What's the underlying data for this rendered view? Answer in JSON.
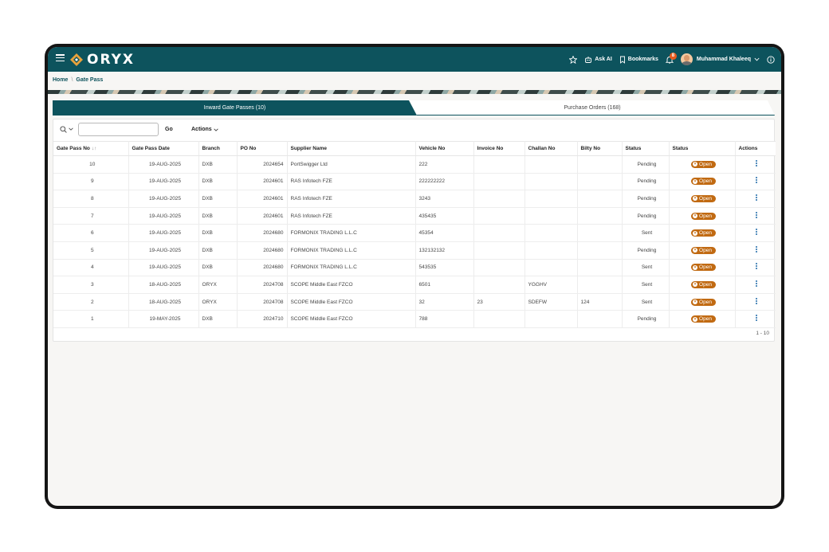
{
  "app": {
    "name": "ORYX"
  },
  "header": {
    "ask_ai": "Ask AI",
    "bookmarks": "Bookmarks",
    "notification_count": "8",
    "user_name": "Muhammad Khaleeq"
  },
  "breadcrumb": {
    "home": "Home",
    "sep": "\\",
    "current": "Gate Pass"
  },
  "tabs": [
    {
      "label": "Inward Gate Passes (10)"
    },
    {
      "label": "Purchase Orders (168)"
    }
  ],
  "toolbar": {
    "search_value": "",
    "go_label": "Go",
    "actions_label": "Actions"
  },
  "table": {
    "columns": [
      "Gate Pass No",
      "Gate Pass Date",
      "Branch",
      "PO No",
      "Supplier Name",
      "Vehicle No",
      "Invoice No",
      "Challan No",
      "Bilty No",
      "Status",
      "Status",
      "Actions"
    ],
    "rows": [
      {
        "no": "10",
        "date": "19-AUG-2025",
        "branch": "DXB",
        "po": "2024654",
        "supplier": "PortSwigger Ltd",
        "vehicle": "222",
        "invoice": "",
        "challan": "",
        "bilty": "",
        "status": "Pending",
        "badge": "Open"
      },
      {
        "no": "9",
        "date": "19-AUG-2025",
        "branch": "DXB",
        "po": "2024601",
        "supplier": "RAS Infotech FZE",
        "vehicle": "222222222",
        "invoice": "",
        "challan": "",
        "bilty": "",
        "status": "Pending",
        "badge": "Open"
      },
      {
        "no": "8",
        "date": "19-AUG-2025",
        "branch": "DXB",
        "po": "2024601",
        "supplier": "RAS Infotech FZE",
        "vehicle": "3243",
        "invoice": "",
        "challan": "",
        "bilty": "",
        "status": "Pending",
        "badge": "Open"
      },
      {
        "no": "7",
        "date": "19-AUG-2025",
        "branch": "DXB",
        "po": "2024601",
        "supplier": "RAS Infotech FZE",
        "vehicle": "435435",
        "invoice": "",
        "challan": "",
        "bilty": "",
        "status": "Pending",
        "badge": "Open"
      },
      {
        "no": "6",
        "date": "19-AUG-2025",
        "branch": "DXB",
        "po": "2024680",
        "supplier": "FORMONIX TRADING L.L.C",
        "vehicle": "45354",
        "invoice": "",
        "challan": "",
        "bilty": "",
        "status": "Sent",
        "badge": "Open"
      },
      {
        "no": "5",
        "date": "19-AUG-2025",
        "branch": "DXB",
        "po": "2024680",
        "supplier": "FORMONIX TRADING L.L.C",
        "vehicle": "132132132",
        "invoice": "",
        "challan": "",
        "bilty": "",
        "status": "Pending",
        "badge": "Open"
      },
      {
        "no": "4",
        "date": "19-AUG-2025",
        "branch": "DXB",
        "po": "2024680",
        "supplier": "FORMONIX TRADING L.L.C",
        "vehicle": "543535",
        "invoice": "",
        "challan": "",
        "bilty": "",
        "status": "Sent",
        "badge": "Open"
      },
      {
        "no": "3",
        "date": "18-AUG-2025",
        "branch": "ORYX",
        "po": "2024708",
        "supplier": "SCOPE Middle East FZCO",
        "vehicle": "6501",
        "invoice": "",
        "challan": "YGGHV",
        "bilty": "",
        "status": "Sent",
        "badge": "Open"
      },
      {
        "no": "2",
        "date": "18-AUG-2025",
        "branch": "ORYX",
        "po": "2024708",
        "supplier": "SCOPE Middle East FZCO",
        "vehicle": "32",
        "invoice": "23",
        "challan": "SDEFW",
        "bilty": "124",
        "status": "Sent",
        "badge": "Open"
      },
      {
        "no": "1",
        "date": "19-MAY-2025",
        "branch": "DXB",
        "po": "2024710",
        "supplier": "SCOPE Middle East FZCO",
        "vehicle": "788",
        "invoice": "",
        "challan": "",
        "bilty": "",
        "status": "Pending",
        "badge": "Open"
      }
    ]
  },
  "pagination": {
    "range": "1 - 10"
  },
  "colors": {
    "brand": "#0d535d",
    "badge": "#c16a12",
    "link": "#1f6aa8"
  },
  "icons": [
    "menu-icon",
    "oryx-logo-icon",
    "star-icon",
    "ai-robot-icon",
    "bookmark-icon",
    "bell-icon",
    "avatar",
    "chevron-down-icon",
    "info-icon",
    "search-icon",
    "sort-icon",
    "close-circle-icon",
    "kebab-icon"
  ]
}
